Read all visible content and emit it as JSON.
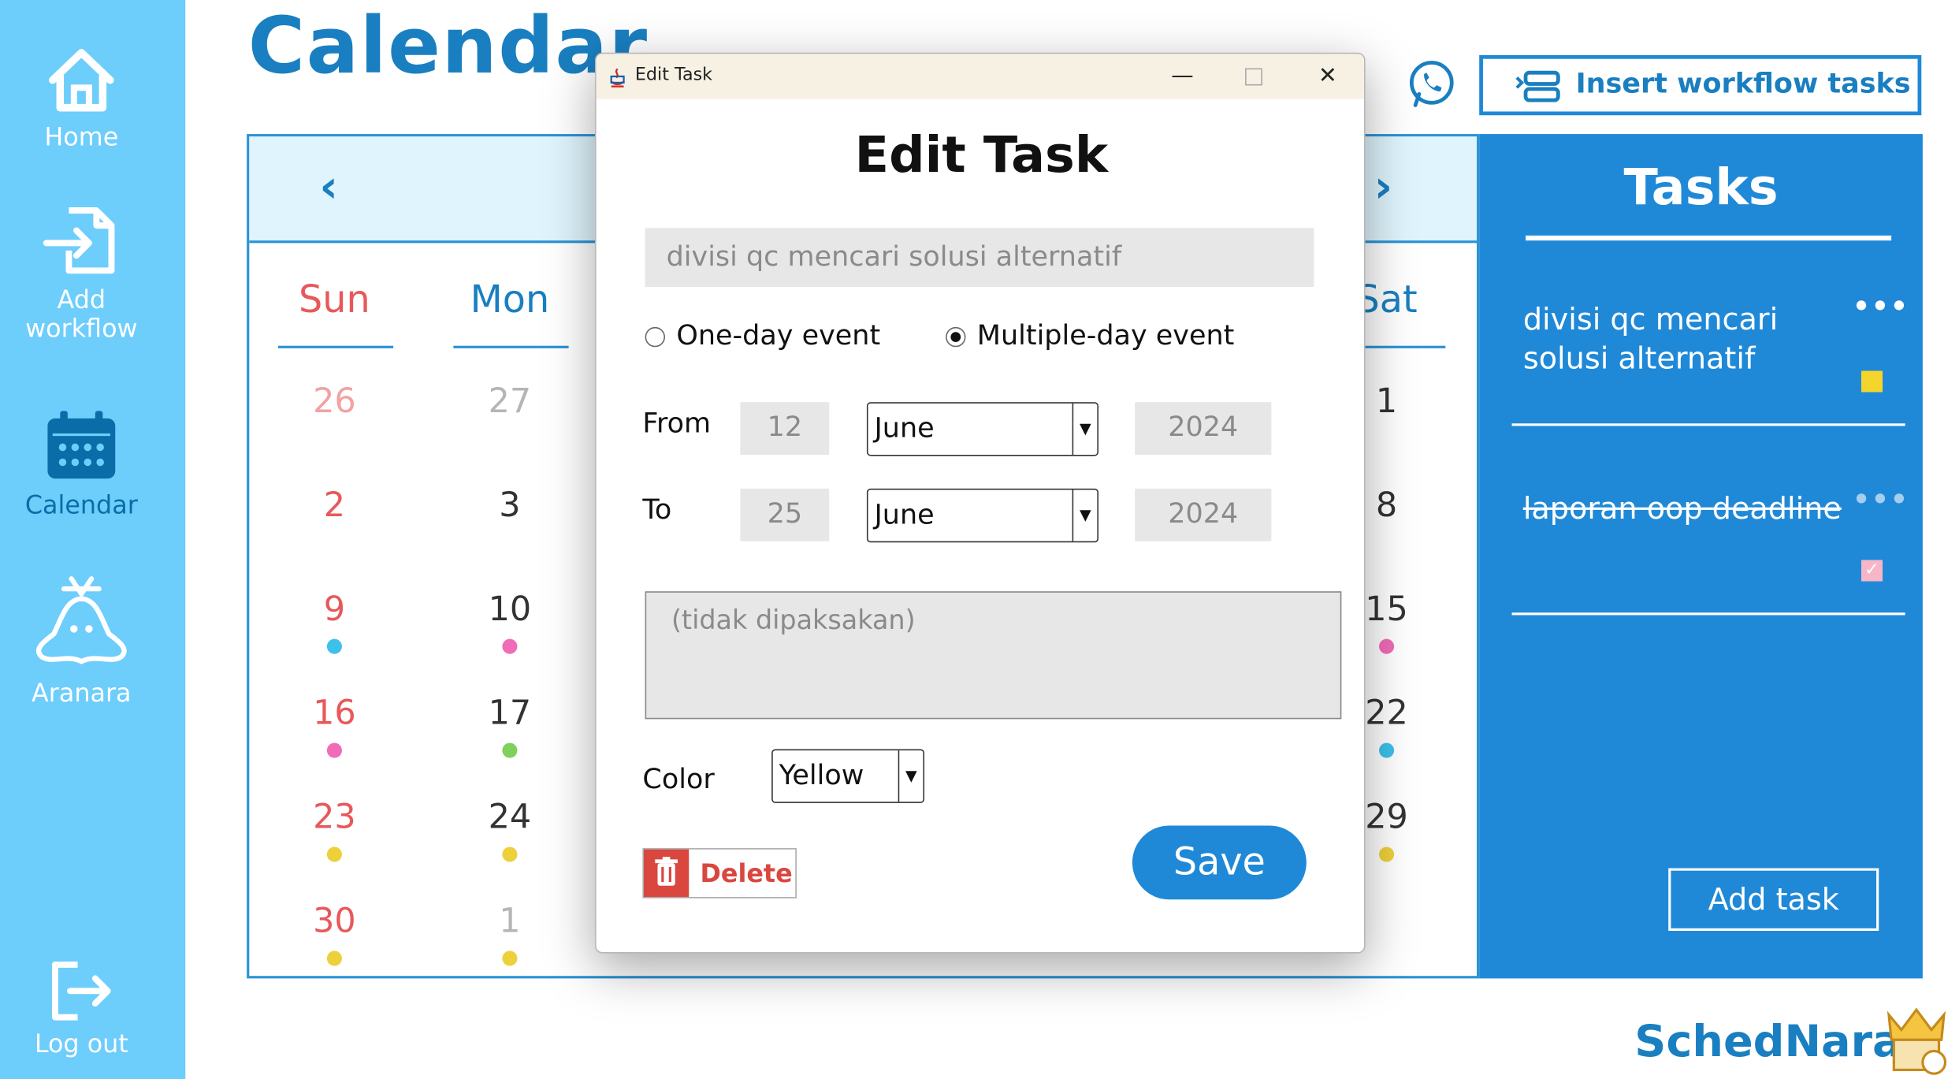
{
  "sidebar": {
    "items": [
      {
        "label": "Home",
        "icon": "home-icon"
      },
      {
        "label": "Add workflow",
        "icon": "file-import-icon"
      },
      {
        "label": "Calendar",
        "icon": "calendar-icon",
        "active": true
      },
      {
        "label": "Aranara",
        "icon": "aranara-icon"
      }
    ],
    "logout": "Log out"
  },
  "page": {
    "title": "Calendar",
    "insert_workflow_label": "Insert workflow tasks",
    "brand": "SchedNara"
  },
  "calendar": {
    "day_names": [
      "Sun",
      "Mon",
      "Sat"
    ],
    "sun": [
      "26",
      "2",
      "9",
      "16",
      "23",
      "30"
    ],
    "mon": [
      "27",
      "3",
      "10",
      "17",
      "24",
      "1"
    ],
    "sat": [
      "1",
      "8",
      "15",
      "22",
      "29"
    ],
    "colors": {
      "cyan": "#3ec0ea",
      "pink": "#f16cb8",
      "green": "#7fd15b",
      "yellow": "#ecd13b",
      "sun_red": "#e8585b",
      "muted": "#b5b5b5"
    }
  },
  "tasks": {
    "title": "Tasks",
    "items": [
      {
        "text": "divisi qc mencari solusi alternatif",
        "done": false,
        "color": "#f5d52c"
      },
      {
        "text": "laporan oop deadline",
        "done": true,
        "color": "#f7b6c7"
      }
    ],
    "add_label": "Add task"
  },
  "dialog": {
    "window_title": "Edit Task",
    "heading": "Edit Task",
    "task_name": "divisi qc mencari solusi alternatif",
    "event_types": [
      "One-day event",
      "Multiple-day event"
    ],
    "selected_event_type": "Multiple-day event",
    "from_label": "From",
    "to_label": "To",
    "from": {
      "day": "12",
      "month": "June",
      "year": "2024"
    },
    "to": {
      "day": "25",
      "month": "June",
      "year": "2024"
    },
    "notes_placeholder": "(tidak dipaksakan)",
    "color_label": "Color",
    "color_value": "Yellow",
    "delete_label": "Delete",
    "save_label": "Save"
  }
}
